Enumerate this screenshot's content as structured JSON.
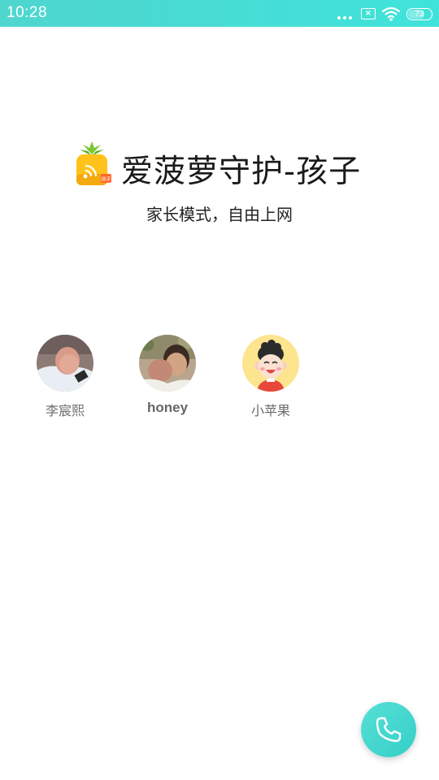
{
  "status_bar": {
    "time": "10:28",
    "battery": "73",
    "notification_badge": "×",
    "icons": [
      "more-dots-icon",
      "notification-icon",
      "wifi-icon",
      "battery-icon"
    ],
    "bg_color": "#45dcd4"
  },
  "brand": {
    "logo_icon": "pineapple-logo-icon",
    "logo_badge": "孩子",
    "title": "爱菠萝守护-孩子",
    "subtitle": "家长模式，自由上网"
  },
  "contacts": [
    {
      "name": "李宸熙",
      "avatar": "photo-avatar"
    },
    {
      "name": "honey",
      "avatar": "photo-avatar"
    },
    {
      "name": "小苹果",
      "avatar": "cartoon-avatar"
    }
  ],
  "call_button": {
    "icon": "phone-icon",
    "color": "#3ed6ce"
  }
}
